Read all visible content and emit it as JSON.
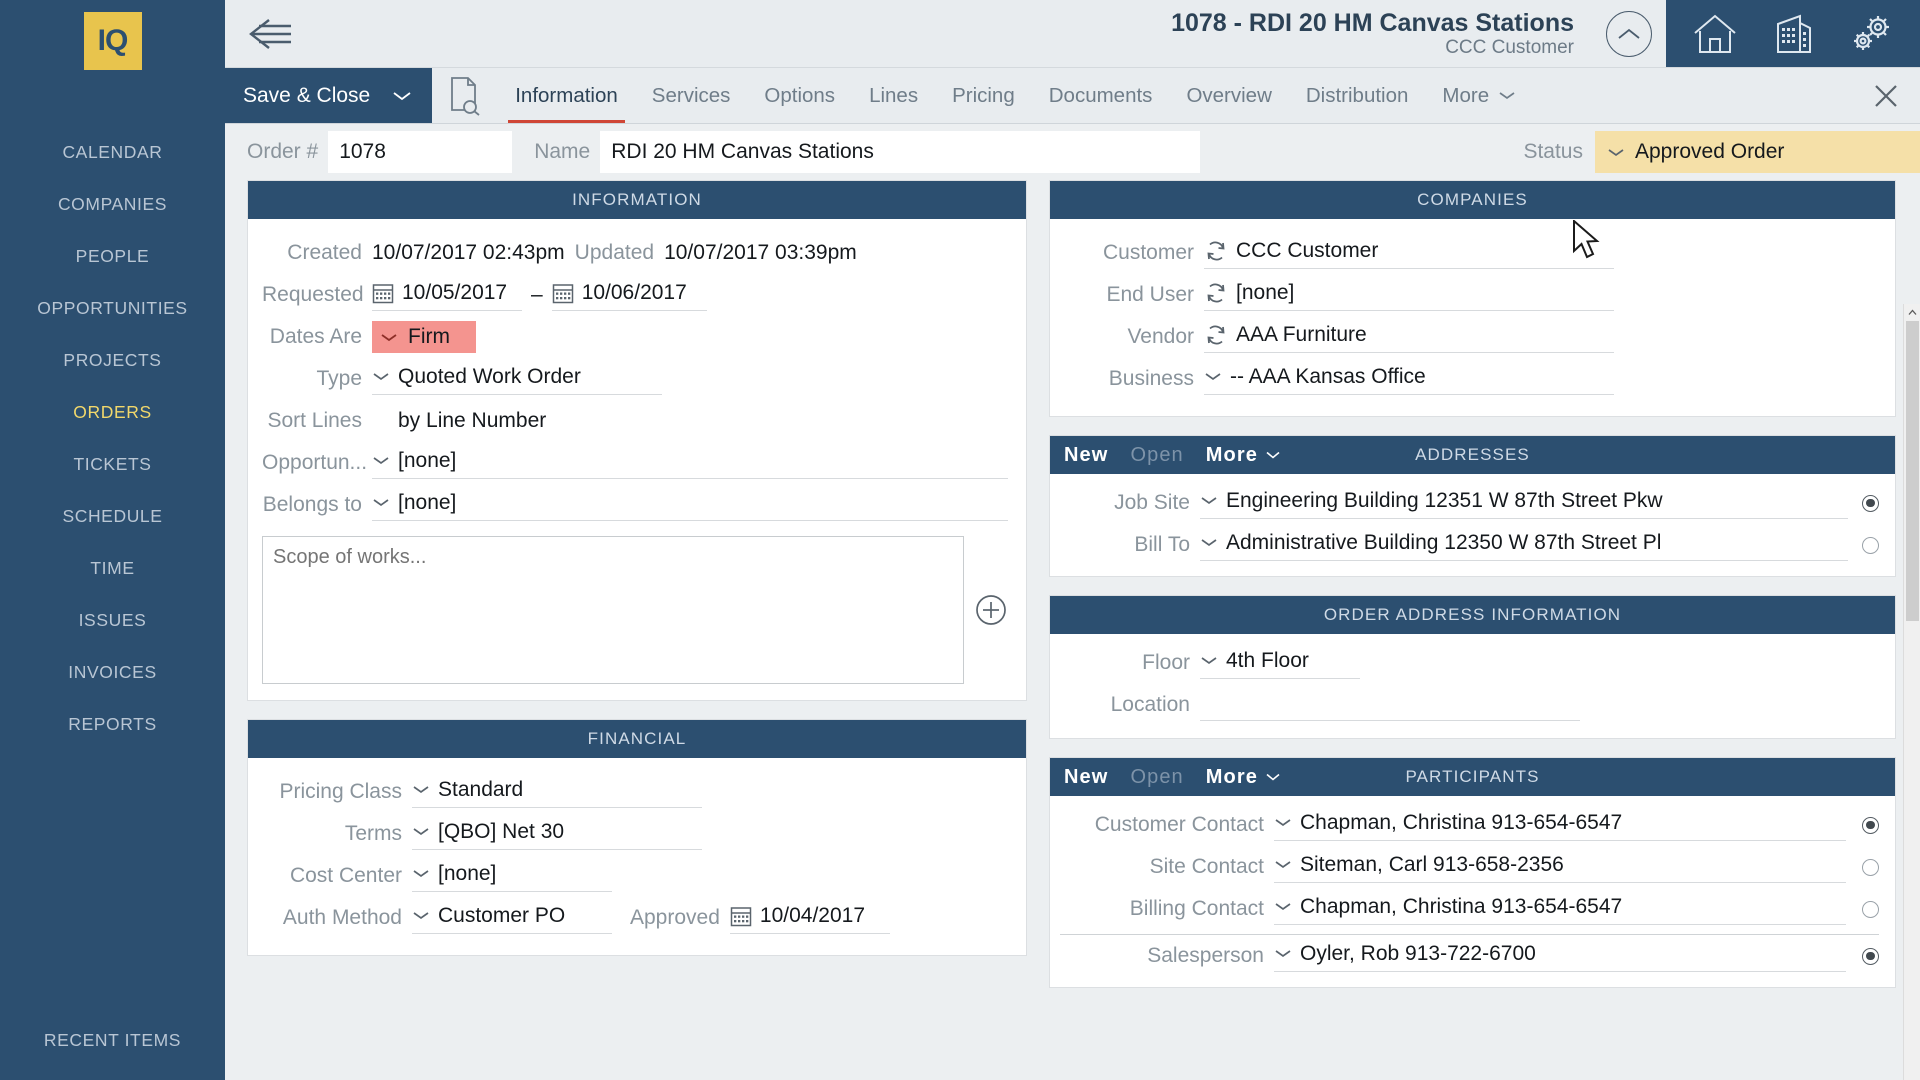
{
  "sidebar": {
    "logo_text": "IQ",
    "items": [
      {
        "label": "CALENDAR",
        "active": false
      },
      {
        "label": "COMPANIES",
        "active": false
      },
      {
        "label": "PEOPLE",
        "active": false
      },
      {
        "label": "OPPORTUNITIES",
        "active": false
      },
      {
        "label": "PROJECTS",
        "active": false
      },
      {
        "label": "ORDERS",
        "active": true
      },
      {
        "label": "TICKETS",
        "active": false
      },
      {
        "label": "SCHEDULE",
        "active": false
      },
      {
        "label": "TIME",
        "active": false
      },
      {
        "label": "ISSUES",
        "active": false
      },
      {
        "label": "INVOICES",
        "active": false
      },
      {
        "label": "REPORTS",
        "active": false
      }
    ],
    "recent_items_label": "RECENT ITEMS"
  },
  "titlebar": {
    "title": "1078 - RDI 20 HM Canvas Stations",
    "subtitle": "CCC Customer",
    "back_icon": "back-arrow-icon",
    "collapse_icon": "chevron-up-circle-icon",
    "icons": [
      "home-icon",
      "building-icon",
      "gears-icon"
    ]
  },
  "tabbar": {
    "save_close_label": "Save & Close",
    "doc_search_icon": "document-search-icon",
    "tabs": [
      {
        "label": "Information",
        "active": true
      },
      {
        "label": "Services",
        "active": false
      },
      {
        "label": "Options",
        "active": false
      },
      {
        "label": "Lines",
        "active": false
      },
      {
        "label": "Pricing",
        "active": false
      },
      {
        "label": "Documents",
        "active": false
      },
      {
        "label": "Overview",
        "active": false
      },
      {
        "label": "Distribution",
        "active": false
      }
    ],
    "more_label": "More",
    "close_icon": "close-icon"
  },
  "formhead": {
    "order_no_label": "Order #",
    "order_no_value": "1078",
    "name_label": "Name",
    "name_value": "RDI 20 HM Canvas Stations",
    "status_label": "Status",
    "status_value": "Approved Order",
    "status_bg": "#f5e0a8"
  },
  "information": {
    "title": "INFORMATION",
    "created_label": "Created",
    "created_value": "10/07/2017 02:43pm",
    "updated_label": "Updated",
    "updated_value": "10/07/2017 03:39pm",
    "requested_label": "Requested",
    "requested_from": "10/05/2017",
    "requested_dash": "–",
    "requested_to": "10/06/2017",
    "dates_are_label": "Dates Are",
    "dates_are_value": "Firm",
    "dates_are_bg": "#f4948f",
    "type_label": "Type",
    "type_value": "Quoted Work Order",
    "sort_lines_label": "Sort Lines",
    "sort_lines_value": "by Line Number",
    "opportunity_label": "Opportun...",
    "opportunity_value": "[none]",
    "belongs_to_label": "Belongs to",
    "belongs_to_value": "[none]",
    "scope_placeholder": "Scope of works...",
    "scope_value": "",
    "add_icon": "plus-circle-icon"
  },
  "financial": {
    "title": "FINANCIAL",
    "pricing_class_label": "Pricing Class",
    "pricing_class_value": "Standard",
    "terms_label": "Terms",
    "terms_value": "[QBO] Net 30",
    "cost_center_label": "Cost Center",
    "cost_center_value": "[none]",
    "auth_method_label": "Auth Method",
    "auth_method_value": "Customer PO",
    "approved_label": "Approved",
    "approved_value": "10/04/2017"
  },
  "companies": {
    "title": "COMPANIES",
    "customer_label": "Customer",
    "customer_value": "CCC Customer",
    "end_user_label": "End User",
    "end_user_value": "[none]",
    "vendor_label": "Vendor",
    "vendor_value": "AAA Furniture",
    "business_label": "Business",
    "business_value": "-- AAA Kansas Office",
    "swap_icon": "refresh-swap-icon"
  },
  "addresses": {
    "title": "ADDRESSES",
    "new_label": "New",
    "open_label": "Open",
    "more_label": "More",
    "rows": [
      {
        "label": "Job Site",
        "value": "Engineering Building 12351 W 87th Street Pkw",
        "selected": true
      },
      {
        "label": "Bill To",
        "value": "Administrative Building 12350 W 87th Street Pl",
        "selected": false
      }
    ]
  },
  "order_address_information": {
    "title": "ORDER ADDRESS INFORMATION",
    "floor_label": "Floor",
    "floor_value": "4th Floor",
    "location_label": "Location",
    "location_value": ""
  },
  "participants": {
    "title": "PARTICIPANTS",
    "new_label": "New",
    "open_label": "Open",
    "more_label": "More",
    "rows": [
      {
        "label": "Customer Contact",
        "value": "Chapman, Christina 913-654-6547",
        "selected": true
      },
      {
        "label": "Site Contact",
        "value": "Siteman, Carl 913-658-2356",
        "selected": false
      },
      {
        "label": "Billing Contact",
        "value": "Chapman, Christina 913-654-6547",
        "selected": false
      },
      {
        "label": "Salesperson",
        "value": "Oyler, Rob 913-722-6700",
        "selected": true
      }
    ]
  },
  "colors": {
    "brand_navy": "#2c4f70",
    "accent_yellow": "#e8c44d",
    "active_tab_underline": "#cf4636",
    "status_bg": "#f5e0a8",
    "firm_bg": "#f4948f"
  }
}
